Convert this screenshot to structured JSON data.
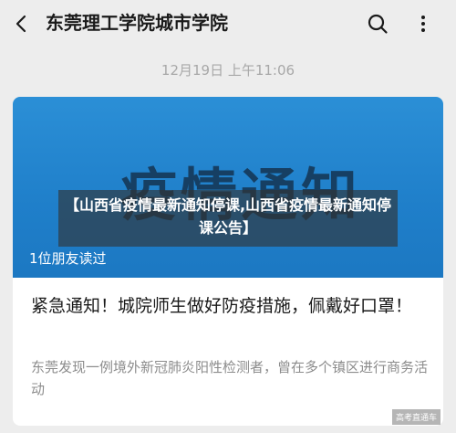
{
  "header": {
    "title": "东莞理工学院城市学院",
    "back_icon": "back-arrow-icon",
    "search_icon": "search-icon",
    "more_icon": "more-icon"
  },
  "message": {
    "timestamp": "12月19日 上午11:06"
  },
  "article": {
    "cover_text": "疫情通知",
    "read_count": "1位朋友读过",
    "overlay_title": "【山西省疫情最新通知停课,山西省疫情最新通知停课公告】",
    "title": "紧急通知！城院师生做好防疫措施，佩戴好口罩！",
    "summary": "东莞发现一例境外新冠肺炎阳性检测者，曾在多个镇区进行商务活动"
  },
  "watermark": "高考直通车",
  "colors": {
    "background": "#ededed",
    "cover_blue": "#1f7fca",
    "overlay": "rgba(50,50,50,0.62)"
  }
}
